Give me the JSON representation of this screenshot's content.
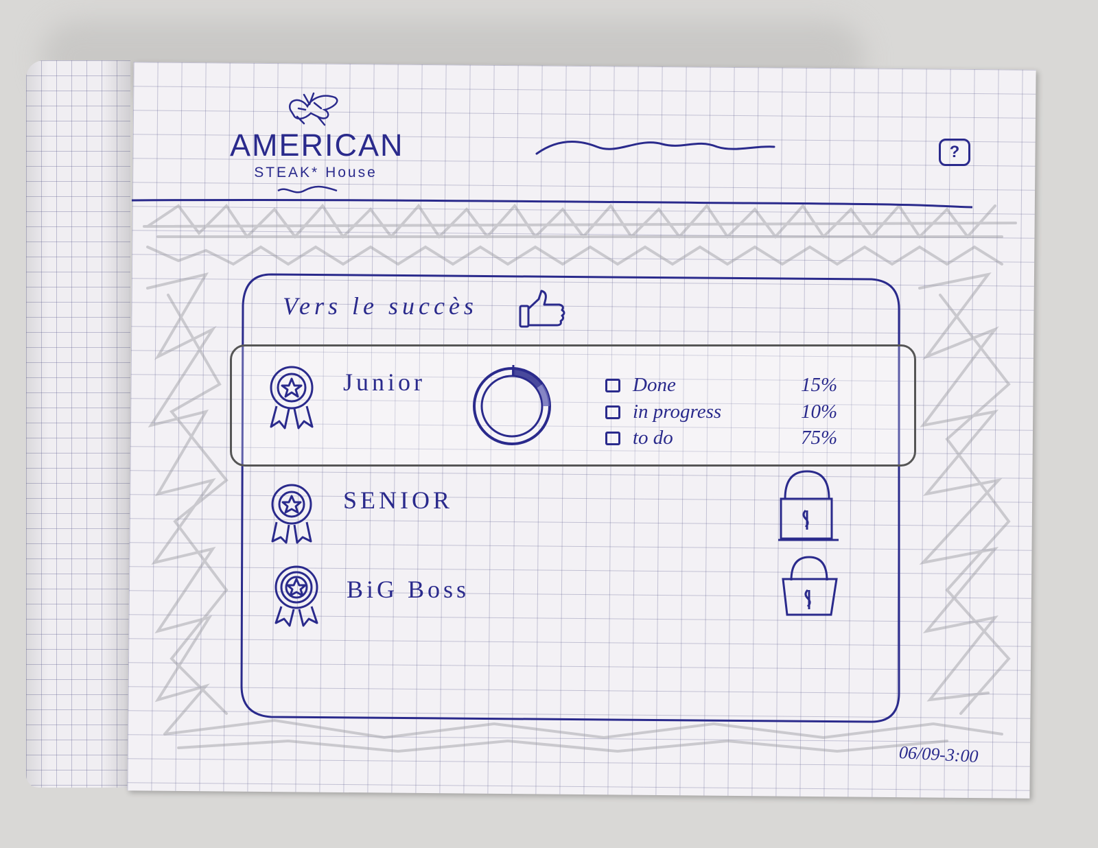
{
  "header": {
    "logo_main": "AMERICAN",
    "logo_sub": "STEAK* House",
    "help_button": "?"
  },
  "panel": {
    "title": "Vers le succès"
  },
  "levels": [
    {
      "name": "Junior",
      "state": "active",
      "progress": {
        "done_fraction": 0.15,
        "in_progress_fraction": 0.1,
        "to_do_fraction": 0.75
      },
      "legend": [
        {
          "label": "Done",
          "value": "15%"
        },
        {
          "label": "in progress",
          "value": "10%"
        },
        {
          "label": "to do",
          "value": "75%"
        }
      ]
    },
    {
      "name": "SENIOR",
      "state": "locked"
    },
    {
      "name": "BiG Boss",
      "state": "locked"
    }
  ],
  "footer": {
    "timestamp": "06/09-3:00"
  },
  "icons": {
    "header": [
      "butterfly-icon",
      "help-icon"
    ],
    "panel": [
      "thumbs-up-icon"
    ],
    "levels": [
      "medal-icon",
      "progress-ring-icon",
      "lock-icon"
    ]
  },
  "colors": {
    "ink": "#2a2a8c",
    "paper": "#f3f1f5",
    "grid": "#8a8ab4"
  }
}
